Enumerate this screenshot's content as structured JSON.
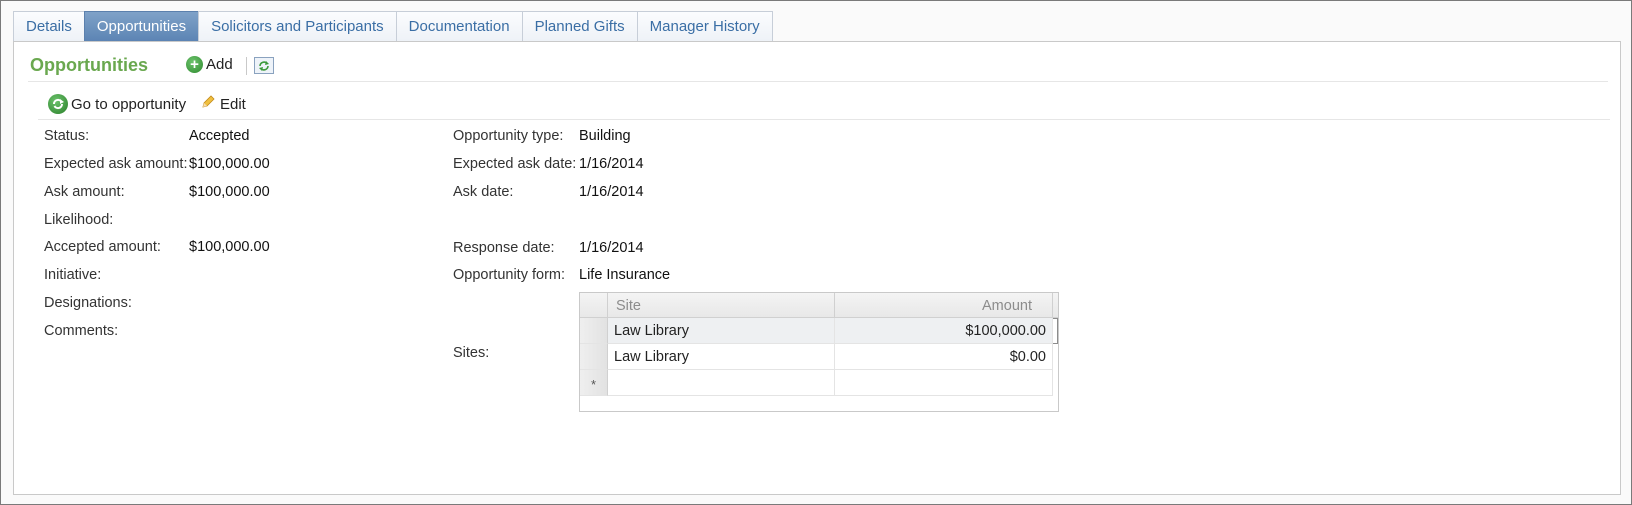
{
  "tabs": [
    "Details",
    "Opportunities",
    "Solicitors and Participants",
    "Documentation",
    "Planned Gifts",
    "Manager History"
  ],
  "active_tab": "Opportunities",
  "section": {
    "title": "Opportunities",
    "add_label": "Add"
  },
  "actions": {
    "goto_label": "Go to opportunity",
    "edit_label": "Edit"
  },
  "left_fields": {
    "status_label": "Status:",
    "status_value": "Accepted",
    "expected_ask_amount_label": "Expected ask amount:",
    "expected_ask_amount_value": "$100,000.00",
    "ask_amount_label": "Ask amount:",
    "ask_amount_value": "$100,000.00",
    "likelihood_label": "Likelihood:",
    "accepted_amount_label": "Accepted amount:",
    "accepted_amount_value": "$100,000.00",
    "initiative_label": "Initiative:",
    "designations_label": "Designations:",
    "comments_label": "Comments:"
  },
  "right_fields": {
    "opportunity_type_label": "Opportunity type:",
    "opportunity_type_value": "Building",
    "expected_ask_date_label": "Expected ask date:",
    "expected_ask_date_value": "1/16/2014",
    "ask_date_label": "Ask date:",
    "ask_date_value": "1/16/2014",
    "response_date_label": "Response date:",
    "response_date_value": "1/16/2014",
    "opportunity_form_label": "Opportunity form:",
    "opportunity_form_value": "Life Insurance",
    "sites_label": "Sites:"
  },
  "sites_grid": {
    "columns": [
      "Site",
      "Amount"
    ],
    "rows": [
      {
        "site": "Law Library",
        "amount": "$100,000.00"
      },
      {
        "site": "Law Library",
        "amount": "$0.00"
      }
    ],
    "new_row_marker": "*"
  },
  "colors": {
    "section_title": "#6aa84f",
    "active_tab_bg": "#5c84b4",
    "tab_text": "#3a6ea5"
  },
  "icons": [
    "plus-icon",
    "refresh-icon",
    "go-to-icon",
    "pencil-icon"
  ]
}
